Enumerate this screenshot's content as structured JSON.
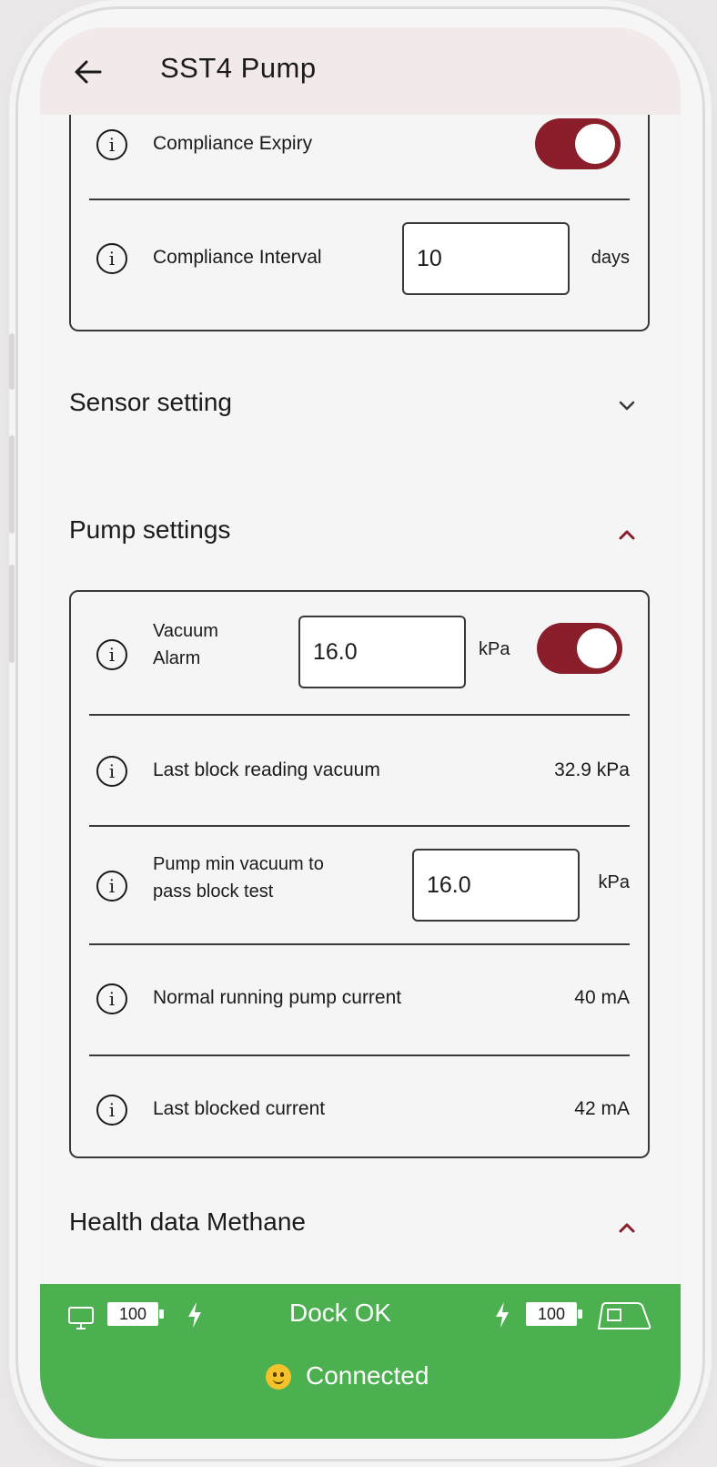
{
  "header": {
    "title": "SST4 Pump"
  },
  "compliance": {
    "expiry_label": "Compliance Expiry",
    "expiry_enabled": true,
    "interval_label": "Compliance Interval",
    "interval_value": "10",
    "interval_unit": "days"
  },
  "sections": {
    "sensor_title": "Sensor setting",
    "pump_title": "Pump settings",
    "health_title": "Health data Methane"
  },
  "pump": {
    "vacuum_alarm_label_line1": "Vacuum",
    "vacuum_alarm_label_line2": "Alarm",
    "vacuum_alarm_value": "16.0",
    "vacuum_alarm_unit": "kPa",
    "vacuum_alarm_enabled": true,
    "last_block_label": "Last block reading vacuum",
    "last_block_value": "32.9 kPa",
    "min_vacuum_label_line1": "Pump min vacuum to",
    "min_vacuum_label_line2": "pass block test",
    "min_vacuum_value": "16.0",
    "min_vacuum_unit": "kPa",
    "normal_current_label": "Normal running pump current",
    "normal_current_value": "40 mA",
    "blocked_current_label": "Last blocked current",
    "blocked_current_value": "42 mA"
  },
  "footer": {
    "left_battery": "100",
    "dock_status": "Dock OK",
    "right_battery": "100",
    "connection": "Connected"
  },
  "colors": {
    "accent": "#8a1e2a",
    "footer_bg": "#4caf50",
    "header_bg": "#f2eaea"
  },
  "icons": [
    "back-arrow-icon",
    "info-icon",
    "chevron-down-icon",
    "chevron-up-icon",
    "monitor-icon",
    "bolt-icon",
    "device-icon",
    "smiley-icon"
  ]
}
